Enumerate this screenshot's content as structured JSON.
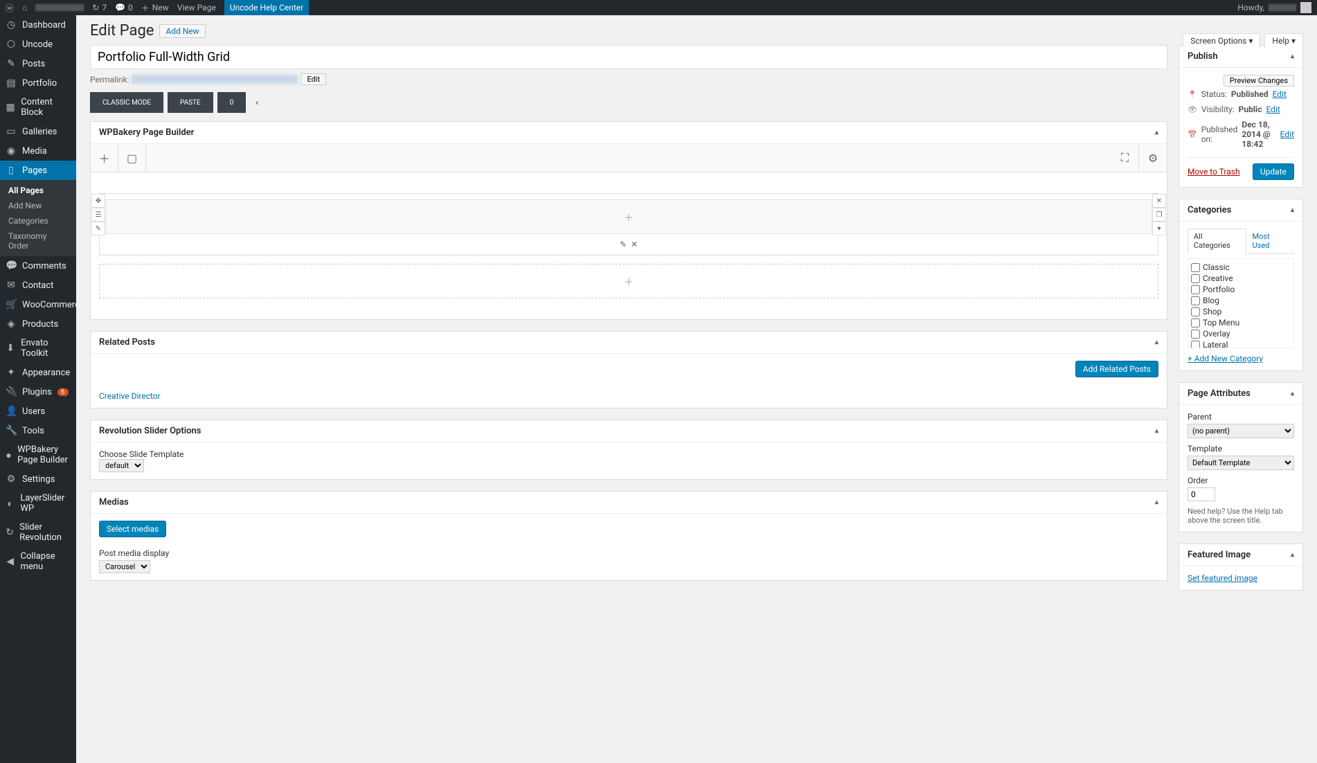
{
  "adminbar": {
    "comments_count": "7",
    "notif_count": "0",
    "new_label": "New",
    "view_page": "View Page",
    "help_center": "Uncode Help Center",
    "howdy": "Howdy,"
  },
  "sidebar": {
    "items": [
      {
        "icon": "◷",
        "label": "Dashboard"
      },
      {
        "icon": "⬡",
        "label": "Uncode"
      },
      {
        "icon": "✎",
        "label": "Posts"
      },
      {
        "icon": "▤",
        "label": "Portfolio"
      },
      {
        "icon": "▦",
        "label": "Content Block"
      },
      {
        "icon": "▭",
        "label": "Galleries"
      },
      {
        "icon": "◉",
        "label": "Media"
      },
      {
        "icon": "▯",
        "label": "Pages",
        "current": true
      },
      {
        "icon": "💬",
        "label": "Comments"
      },
      {
        "icon": "✉",
        "label": "Contact"
      },
      {
        "icon": "🛒",
        "label": "WooCommerce"
      },
      {
        "icon": "◈",
        "label": "Products"
      },
      {
        "icon": "⬇",
        "label": "Envato Toolkit"
      },
      {
        "icon": "✦",
        "label": "Appearance"
      },
      {
        "icon": "🔌",
        "label": "Plugins",
        "badge": "6"
      },
      {
        "icon": "👤",
        "label": "Users"
      },
      {
        "icon": "🔧",
        "label": "Tools"
      },
      {
        "icon": "●",
        "label": "WPBakery Page Builder"
      },
      {
        "icon": "⚙",
        "label": "Settings"
      },
      {
        "icon": "◐",
        "label": "LayerSlider WP"
      },
      {
        "icon": "↻",
        "label": "Slider Revolution"
      },
      {
        "icon": "◀",
        "label": "Collapse menu"
      }
    ],
    "submenu": [
      {
        "label": "All Pages",
        "current": true
      },
      {
        "label": "Add New"
      },
      {
        "label": "Categories"
      },
      {
        "label": "Taxonomy Order"
      }
    ]
  },
  "header": {
    "title": "Edit Page",
    "add_new": "Add New",
    "screen_options": "Screen Options ▾",
    "help": "Help ▾"
  },
  "editor": {
    "title_value": "Portfolio Full-Width Grid",
    "permalink_label": "Permalink:",
    "edit_btn": "Edit",
    "classic_mode": "CLASSIC MODE",
    "paste": "PASTE",
    "zero": "0"
  },
  "wpbakery": {
    "title": "WPBakery Page Builder"
  },
  "related": {
    "title": "Related Posts",
    "add_btn": "Add Related Posts",
    "link": "Creative Director"
  },
  "revslider": {
    "title": "Revolution Slider Options",
    "choose_label": "Choose Slide Template",
    "default_option": "default"
  },
  "medias": {
    "title": "Medias",
    "select_btn": "Select medias",
    "display_label": "Post media display",
    "carousel_option": "Carousel"
  },
  "publish": {
    "title": "Publish",
    "preview": "Preview Changes",
    "status_label": "Status:",
    "status_value": "Published",
    "visibility_label": "Visibility:",
    "visibility_value": "Public",
    "published_label": "Published on:",
    "published_value": "Dec 18, 2014 @ 18:42",
    "edit": "Edit",
    "trash": "Move to Trash",
    "update": "Update"
  },
  "categories": {
    "title": "Categories",
    "tab_all": "All Categories",
    "tab_most": "Most Used",
    "items": [
      "Classic",
      "Creative",
      "Portfolio",
      "Blog",
      "Shop",
      "Top Menu",
      "Overlay",
      "Lateral"
    ],
    "add_new": "+ Add New Category"
  },
  "attributes": {
    "title": "Page Attributes",
    "parent_label": "Parent",
    "parent_value": "(no parent)",
    "template_label": "Template",
    "template_value": "Default Template",
    "order_label": "Order",
    "order_value": "0",
    "help_text": "Need help? Use the Help tab above the screen title."
  },
  "featured": {
    "title": "Featured Image",
    "set_link": "Set featured image"
  }
}
